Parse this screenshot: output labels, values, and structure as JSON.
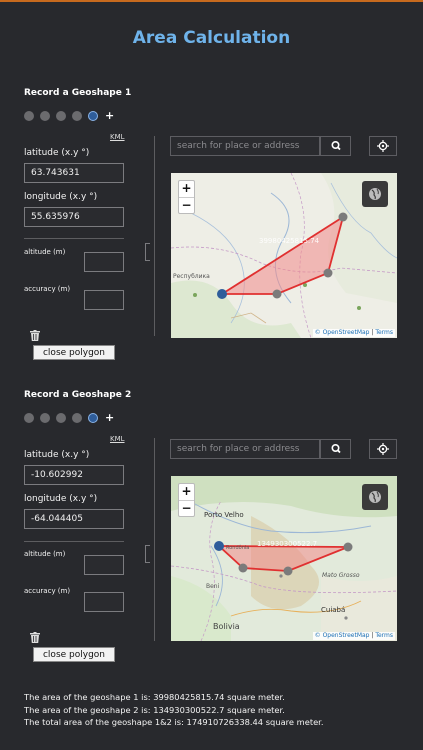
{
  "title": "Area Calculation",
  "sections": [
    {
      "title": "Record a Geoshape 1",
      "plus": "+",
      "kml": "KML",
      "latitude_label": "latitude (x.y °)",
      "latitude_value": "63.743631",
      "longitude_label": "longitude (x.y °)",
      "longitude_value": "55.635976",
      "altitude_label": "altitude (m)",
      "accuracy_label": "accuracy (m)",
      "close_polygon": "close polygon",
      "search_placeholder": "search for place or address",
      "map": {
        "zoom_in": "+",
        "zoom_out": "−",
        "area_label": "39980425815.74",
        "place_label": "Республика",
        "attribution_link": "© OpenStreetMap",
        "attribution_sep": " | ",
        "attribution_terms": "Terms"
      }
    },
    {
      "title": "Record a Geoshape 2",
      "plus": "+",
      "kml": "KML",
      "latitude_label": "latitude (x.y °)",
      "latitude_value": "-10.602992",
      "longitude_label": "longitude (x.y °)",
      "longitude_value": "-64.044405",
      "altitude_label": "altitude (m)",
      "accuracy_label": "accuracy (m)",
      "close_polygon": "close polygon",
      "search_placeholder": "search for place or address",
      "map": {
        "zoom_in": "+",
        "zoom_out": "−",
        "area_label": "134930300522.7",
        "place_porto": "Porto Velho",
        "place_rondonia": "Rondônia",
        "place_beni": "Beni",
        "place_bolivia": "Bolivia",
        "place_mato": "Mato Grosso",
        "place_cuiaba": "Cuiabá",
        "attribution_link": "© OpenStreetMap",
        "attribution_sep": " | ",
        "attribution_terms": "Terms"
      }
    }
  ],
  "results": {
    "line1": "The area of the geoshape 1 is: 39980425815.74 square meter.",
    "line2": "The area of the geoshape 2 is: 134930300522.7 square meter.",
    "line3": "The total area of the geoshape 1&2 is: 174910726338.44 square meter."
  },
  "colors": {
    "title": "#6fb3ea",
    "polygon_stroke": "#e03030",
    "polygon_fill": "#f28a8a",
    "active_dot": "#2f5d9a"
  },
  "icons": [
    "plus-icon",
    "trash-icon",
    "search-icon",
    "crosshair-icon",
    "globe-layers-icon"
  ]
}
